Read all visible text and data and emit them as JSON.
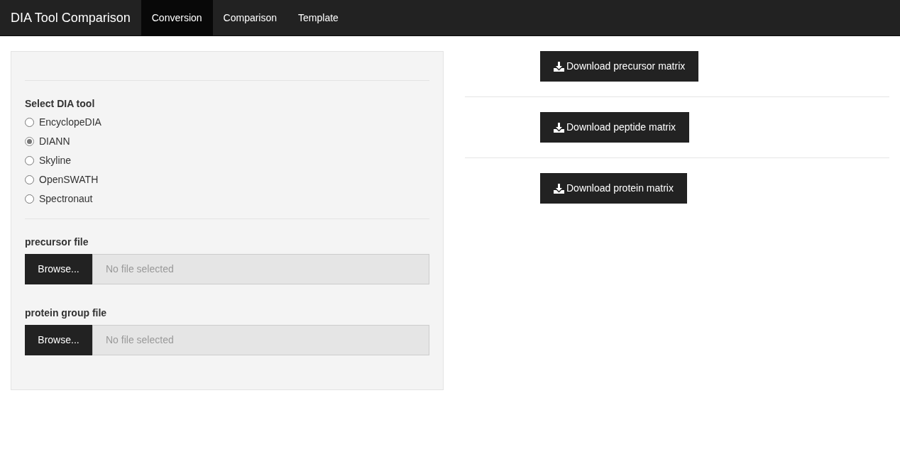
{
  "navbar": {
    "brand": "DIA Tool Comparison",
    "tabs": [
      {
        "label": "Conversion",
        "selected": true
      },
      {
        "label": "Comparison",
        "selected": false
      },
      {
        "label": "Template",
        "selected": false
      }
    ]
  },
  "sidebar": {
    "tool_select": {
      "label": "Select DIA tool",
      "options": [
        {
          "label": "EncyclopeDIA",
          "selected": false
        },
        {
          "label": "DIANN",
          "selected": true
        },
        {
          "label": "Skyline",
          "selected": false
        },
        {
          "label": "OpenSWATH",
          "selected": false
        },
        {
          "label": "Spectronaut",
          "selected": false
        }
      ]
    },
    "file_inputs": [
      {
        "label": "precursor file",
        "button": "Browse...",
        "placeholder": "No file selected"
      },
      {
        "label": "protein group file",
        "button": "Browse...",
        "placeholder": "No file selected"
      }
    ]
  },
  "downloads": [
    "Download precursor matrix",
    "Download peptide matrix",
    "Download protein matrix"
  ]
}
